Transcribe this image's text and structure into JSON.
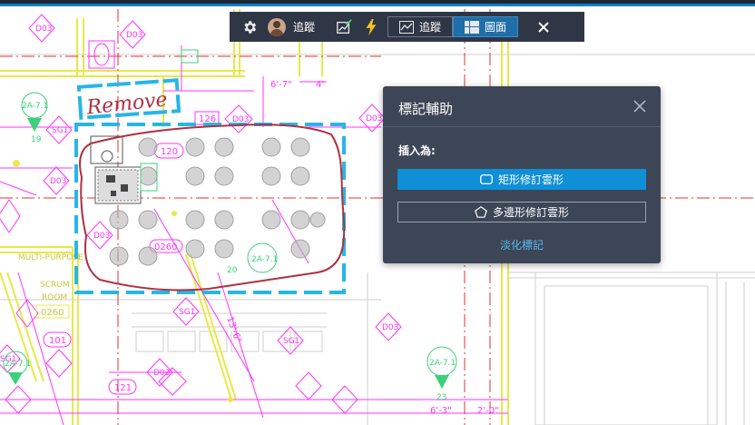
{
  "toolbar": {
    "settings_icon": "gear-icon",
    "user_name": "追蹤",
    "checkmark_icon": "chart-check-icon",
    "bolt_icon": "lightning-icon",
    "tab_track_label": "追蹤",
    "tab_layout_label": "圖面",
    "close_icon": "close-icon"
  },
  "dialog": {
    "title": "標記輔助",
    "insert_label": "插入為:",
    "rect_cloud_label": "矩形修訂雲形",
    "poly_cloud_label": "多邊形修訂雲形",
    "fade_link": "淡化標記"
  },
  "drawing": {
    "markup_text": "Remove",
    "room_tags": [
      "D03",
      "D03",
      "D03",
      "D03",
      "D03",
      "D03",
      "D03",
      "D03",
      "SG1",
      "SG1",
      "SG1",
      "SG1"
    ],
    "grid_tags": [
      "2A-7.1",
      "2A-7.1",
      "2A-7.1",
      "2A-7.1"
    ],
    "grid_numbers": [
      "19",
      "20",
      "23"
    ],
    "room_numbers": [
      "120",
      "126",
      "121",
      "101",
      "0260",
      "0260"
    ],
    "room_name": [
      "MULTI-PURPOSE",
      "SCRUM",
      "ROOM"
    ],
    "dimensions": [
      "6'-7\"",
      "4'",
      "13'-6\"",
      "6'-3\"",
      "2'-0\""
    ]
  },
  "colors": {
    "magenta": "#ff33ff",
    "yellow": "#e8e84a",
    "red": "#e03030",
    "cyan_markup": "#27b6e6",
    "dialog_bg": "#3d4656",
    "toolbar_bg": "#2f3645",
    "primary": "#0e8fd6"
  }
}
